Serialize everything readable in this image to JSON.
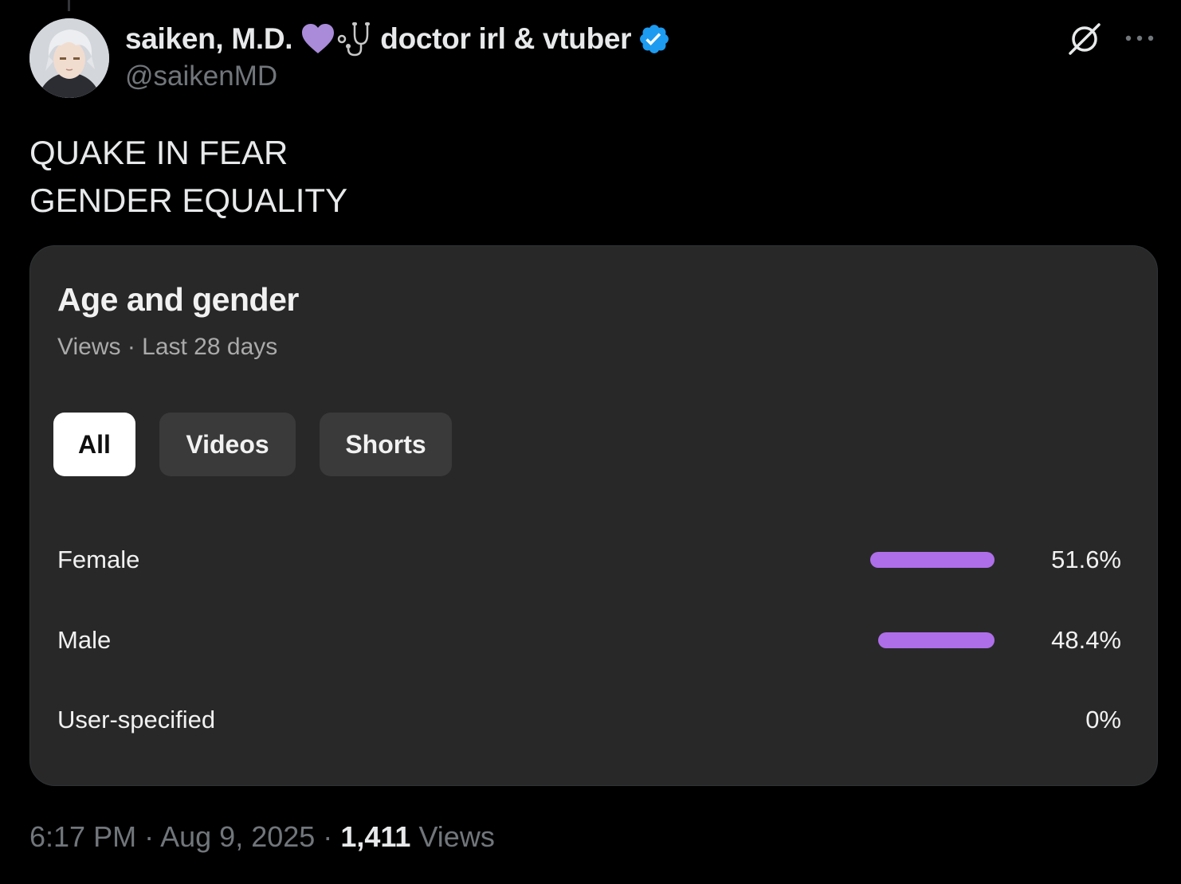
{
  "author": {
    "display_name": "saiken, M.D.",
    "display_suffix": "doctor irl & vtuber",
    "handle": "@saikenMD",
    "heart_emoji": "purple-heart",
    "stethoscope_emoji": "stethoscope",
    "verified": true,
    "verified_color": "#1d9bf0"
  },
  "tweet": {
    "lines": [
      "QUAKE IN FEAR",
      "GENDER EQUALITY"
    ]
  },
  "media": {
    "title": "Age and gender",
    "subtitle": "Views · Last 28 days",
    "tabs": [
      {
        "label": "All",
        "active": true
      },
      {
        "label": "Videos",
        "active": false
      },
      {
        "label": "Shorts",
        "active": false
      }
    ],
    "bar_color": "#ae6ee9",
    "rows": [
      {
        "label": "Female",
        "value_text": "51.6%",
        "value": 51.6
      },
      {
        "label": "Male",
        "value_text": "48.4%",
        "value": 48.4
      },
      {
        "label": "User-specified",
        "value_text": "0%",
        "value": 0
      }
    ]
  },
  "meta": {
    "time": "6:17 PM",
    "sep1": "·",
    "date": "Aug 9, 2025",
    "sep2": "·",
    "views_count": "1,411",
    "views_label": "Views"
  },
  "icons": {
    "grok": "grok-icon",
    "more": "more-options-icon"
  }
}
